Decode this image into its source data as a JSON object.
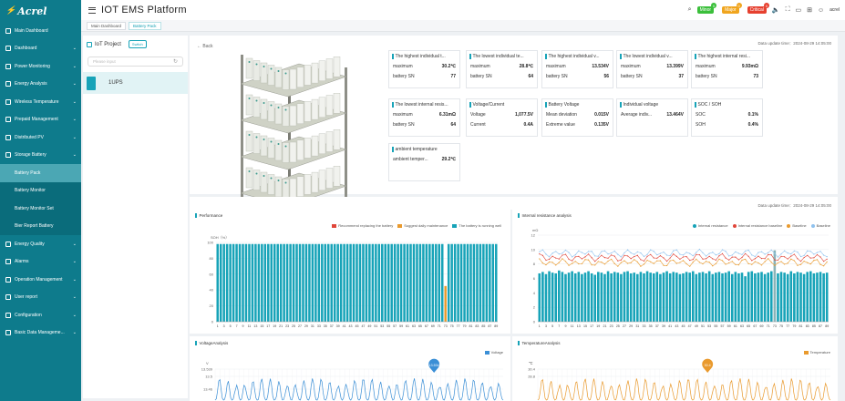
{
  "logo": "Acrel",
  "app_title": "IOT EMS Platform",
  "nav": [
    {
      "label": "Main Dashboard",
      "kind": "top",
      "arrow": false
    },
    {
      "label": "Dashboard",
      "kind": "top",
      "arrow": true
    },
    {
      "label": "Power Monitoring",
      "kind": "top",
      "arrow": true
    },
    {
      "label": "Energy Analysis",
      "kind": "top",
      "arrow": true
    },
    {
      "label": "Wireless Temperature",
      "kind": "top",
      "arrow": true
    },
    {
      "label": "Prepaid Management",
      "kind": "top",
      "arrow": true
    },
    {
      "label": "Distributed PV",
      "kind": "top",
      "arrow": true
    },
    {
      "label": "Storage Battery",
      "kind": "top",
      "arrow": true
    },
    {
      "label": "Battery Pack",
      "kind": "sub",
      "active": true
    },
    {
      "label": "Battery Monitor",
      "kind": "sub"
    },
    {
      "label": "Battery Monitor Set",
      "kind": "sub"
    },
    {
      "label": "Bier Report Battery",
      "kind": "sub"
    },
    {
      "label": "Energy Quality",
      "kind": "top",
      "arrow": true
    },
    {
      "label": "Alarms",
      "kind": "top",
      "arrow": true
    },
    {
      "label": "Operation Management",
      "kind": "top",
      "arrow": true
    },
    {
      "label": "User report",
      "kind": "top",
      "arrow": true
    },
    {
      "label": "Configuration",
      "kind": "top",
      "arrow": true
    },
    {
      "label": "Basic Data Manageme...",
      "kind": "top",
      "arrow": true
    }
  ],
  "alarms": [
    {
      "label": "Minor",
      "count": "0",
      "color": "#3bbf3b",
      "badge": "#3bbf3b"
    },
    {
      "label": "Major",
      "count": "0",
      "color": "#f0a51e",
      "badge": "#f0a51e"
    },
    {
      "label": "Critical",
      "count": "0",
      "color": "#e6402f",
      "badge": "#e6402f"
    }
  ],
  "user": "acrel",
  "tabs": [
    "Main Dashboard",
    "Battery Pack"
  ],
  "tree": {
    "title": "IoT Project",
    "switch_label": "Switch",
    "search_placeholder": "Please input",
    "node": "1UPS"
  },
  "overview": {
    "back_label": "Back",
    "update": "Data update time：2024-08-29 14:05:00",
    "cards": [
      {
        "title": "The highest individual t...",
        "rows": [
          [
            "maximum",
            "30.2℃"
          ],
          [
            "battery SN",
            "77"
          ]
        ]
      },
      {
        "title": "The lowest individual te...",
        "rows": [
          [
            "maximum",
            "28.8℃"
          ],
          [
            "battery SN",
            "64"
          ]
        ]
      },
      {
        "title": "The highest individual v...",
        "rows": [
          [
            "maximum",
            "13.534V"
          ],
          [
            "battery SN",
            "56"
          ]
        ]
      },
      {
        "title": "The lowest individual v...",
        "rows": [
          [
            "maximum",
            "13.399V"
          ],
          [
            "battery SN",
            "37"
          ]
        ]
      },
      {
        "title": "The highest internal resi...",
        "rows": [
          [
            "maximum",
            "9.93mΩ"
          ],
          [
            "battery SN",
            "73"
          ]
        ]
      },
      {
        "title": "The lowest internal resis...",
        "rows": [
          [
            "maximum",
            "6.31mΩ"
          ],
          [
            "battery SN",
            "64"
          ]
        ]
      },
      {
        "title": "Voltage/Current",
        "rows": [
          [
            "Voltage",
            "1,077.5V"
          ],
          [
            "Current",
            "0.4A"
          ]
        ]
      },
      {
        "title": "Battery Voltage",
        "rows": [
          [
            "Mean deviation",
            "0.015V"
          ],
          [
            "Extreme value",
            "0.135V"
          ]
        ]
      },
      {
        "title": "Individual voltage",
        "rows": [
          [
            "Average indiv...",
            "13.464V"
          ]
        ]
      },
      {
        "title": "SOC / SOH",
        "rows": [
          [
            "SOC",
            "0.1%"
          ],
          [
            "SOH",
            "0.4%"
          ]
        ]
      },
      {
        "title": "ambient temperature",
        "rows": [
          [
            "ambient temper...",
            "29.2℃"
          ]
        ]
      }
    ]
  },
  "charts_update": "Data update time：2024-08-29 14:05:00",
  "colors": {
    "accent": "#17a3b8",
    "red": "#e0463a",
    "orange": "#e99a2e",
    "blue": "#3b8fd6",
    "lightblue": "#8fc2ee"
  },
  "chart_data": [
    {
      "type": "bar",
      "title": "Performance",
      "ylabel": "SOH（%）",
      "ylim": [
        0,
        100
      ],
      "yticks": [
        0,
        20,
        40,
        60,
        80,
        100
      ],
      "legend": [
        "Recommend replacing the battery",
        "Suggest daily maintenance",
        "The battery is running well"
      ],
      "categories": [
        1,
        3,
        5,
        7,
        9,
        11,
        13,
        15,
        17,
        19,
        21,
        23,
        25,
        27,
        29,
        31,
        33,
        35,
        37,
        39,
        41,
        43,
        45,
        47,
        49,
        51,
        53,
        55,
        57,
        59,
        61,
        63,
        65,
        67,
        69,
        71,
        73,
        75,
        77,
        79,
        81,
        83,
        85,
        87,
        89
      ],
      "series": [
        {
          "name": "The battery is running well",
          "values": [
            98,
            98,
            98,
            98,
            98,
            98,
            98,
            98,
            98,
            98,
            98,
            98,
            98,
            98,
            98,
            98,
            98,
            98,
            98,
            98,
            98,
            98,
            98,
            98,
            98,
            98,
            98,
            98,
            98,
            98,
            98,
            98,
            98,
            98,
            98,
            98,
            98,
            98,
            98,
            98,
            98,
            98,
            98,
            98,
            98,
            98,
            98,
            98,
            98,
            98,
            98,
            98,
            98,
            98,
            98,
            98,
            98,
            98,
            98,
            98,
            98,
            98,
            98,
            98,
            98,
            98,
            98,
            98,
            98,
            98,
            98,
            98,
            0,
            98,
            98,
            98,
            98,
            98,
            98,
            98,
            98,
            98,
            98,
            98,
            98,
            98,
            98,
            98,
            98
          ]
        },
        {
          "name": "Suggest daily maintenance",
          "values": [
            0,
            0,
            0,
            0,
            0,
            0,
            0,
            0,
            0,
            0,
            0,
            0,
            0,
            0,
            0,
            0,
            0,
            0,
            0,
            0,
            0,
            0,
            0,
            0,
            0,
            0,
            0,
            0,
            0,
            0,
            0,
            0,
            0,
            0,
            0,
            0,
            0,
            0,
            0,
            0,
            0,
            0,
            0,
            0,
            0,
            0,
            0,
            0,
            0,
            0,
            0,
            0,
            0,
            0,
            0,
            0,
            0,
            0,
            0,
            0,
            0,
            0,
            0,
            0,
            0,
            0,
            0,
            0,
            0,
            0,
            0,
            0,
            45,
            0,
            0,
            0,
            0,
            0,
            0,
            0,
            0,
            0,
            0,
            0,
            0,
            0,
            0,
            0,
            0
          ]
        }
      ]
    },
    {
      "type": "bar",
      "title": "Internal resistance analysis",
      "ylabel": "mΩ",
      "ylim": [
        0,
        12
      ],
      "yticks": [
        0,
        2,
        4,
        6,
        8,
        10,
        12
      ],
      "legend": [
        "Internal resistance",
        "Internal resistance baseline",
        "Baseline",
        "Baseline"
      ],
      "categories": [
        1,
        3,
        5,
        7,
        9,
        11,
        13,
        15,
        17,
        19,
        21,
        23,
        25,
        27,
        29,
        31,
        33,
        35,
        37,
        39,
        41,
        43,
        45,
        47,
        49,
        51,
        53,
        55,
        57,
        59,
        61,
        63,
        65,
        67,
        69,
        71,
        73,
        75,
        77,
        79,
        81,
        83,
        85,
        87,
        89
      ],
      "series": [
        {
          "name": "Internal resistance",
          "values": [
            6.7,
            6.9,
            6.6,
            7.0,
            6.8,
            6.7,
            7.1,
            6.9,
            6.6,
            6.8,
            7.0,
            6.7,
            6.9,
            6.6,
            6.8,
            7.0,
            6.7,
            6.5,
            6.9,
            6.8,
            6.6,
            7.0,
            6.7,
            6.9,
            6.8,
            6.6,
            6.9,
            7.0,
            6.7,
            6.8,
            6.6,
            6.9,
            6.7,
            7.0,
            6.8,
            6.7,
            6.9,
            6.6,
            6.8,
            7.0,
            6.7,
            6.9,
            6.8,
            6.6,
            6.7,
            6.9,
            6.8,
            7.0,
            6.6,
            6.8,
            6.9,
            6.7,
            7.0,
            6.6,
            6.8,
            6.9,
            6.7,
            6.8,
            7.0,
            6.6,
            6.9,
            6.7,
            6.8,
            6.3,
            6.9,
            7.0,
            6.7,
            6.8,
            6.9,
            6.6,
            6.8,
            7.0,
            9.9,
            6.7,
            6.9,
            6.8,
            6.6,
            7.0,
            6.7,
            6.9,
            6.8,
            6.6,
            6.9,
            7.0,
            6.7,
            6.8,
            6.9,
            6.7,
            6.8
          ]
        }
      ]
    },
    {
      "type": "line",
      "title": "VoltageAnalysis",
      "ylabel": "V",
      "legend": [
        "Voltage"
      ],
      "yticks": [
        "13.539",
        "13.5",
        "13.46"
      ],
      "max_label": "13.534"
    },
    {
      "type": "line",
      "title": "TemperatureAnalysis",
      "ylabel": "℃",
      "legend": [
        "Temperature"
      ],
      "yticks": [
        "30.4",
        "28.8"
      ],
      "max_label": "30.4"
    }
  ]
}
